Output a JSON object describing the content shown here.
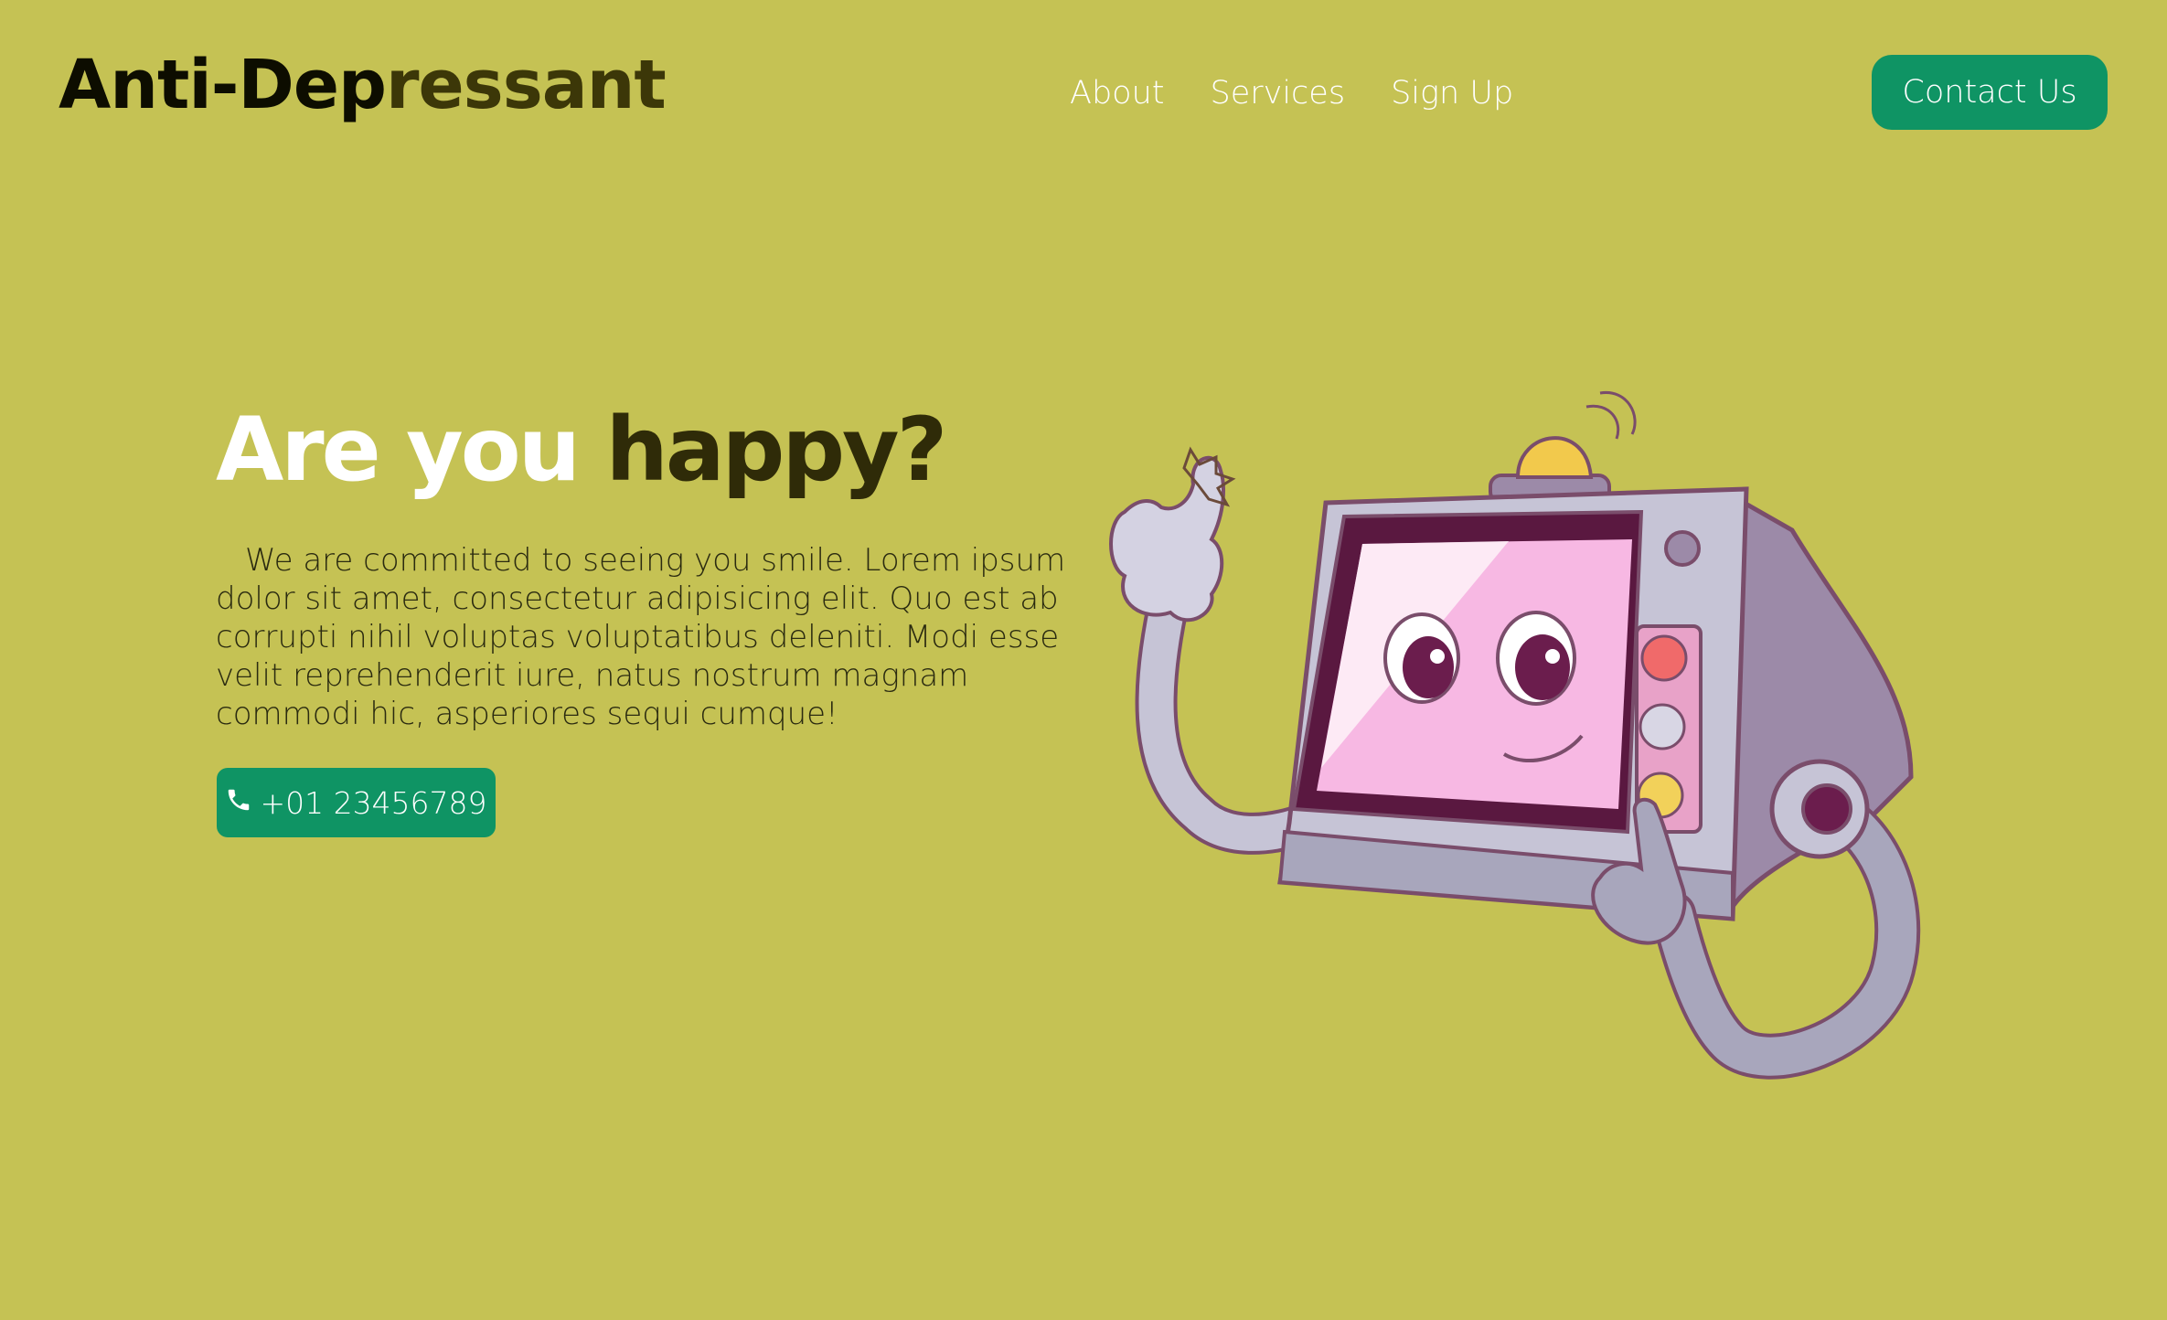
{
  "brand": {
    "part1": "Anti-Dep",
    "part2": "ressant"
  },
  "nav": {
    "items": [
      {
        "label": "About"
      },
      {
        "label": "Services"
      },
      {
        "label": "Sign Up"
      }
    ]
  },
  "header": {
    "contact_label": "Contact Us"
  },
  "hero": {
    "title_light": "Are you ",
    "title_dark": "happy?",
    "text": "We are committed to seeing you smile. Lorem ipsum dolor sit amet, consectetur adipisicing elit. Quo est ab corrupti nihil voluptas voluptatibus deleniti. Modi esse velit reprehenderit iure, natus nostrum magnam commodi hic, asperiores sequi cumque!",
    "phone": "+01 23456789"
  },
  "colors": {
    "background": "#c5c254",
    "accent": "#0f9464",
    "dark_text": "#2f2b08"
  },
  "icons": {
    "phone": "phone-icon",
    "illustration": "retro-tv-robot-illustration"
  }
}
